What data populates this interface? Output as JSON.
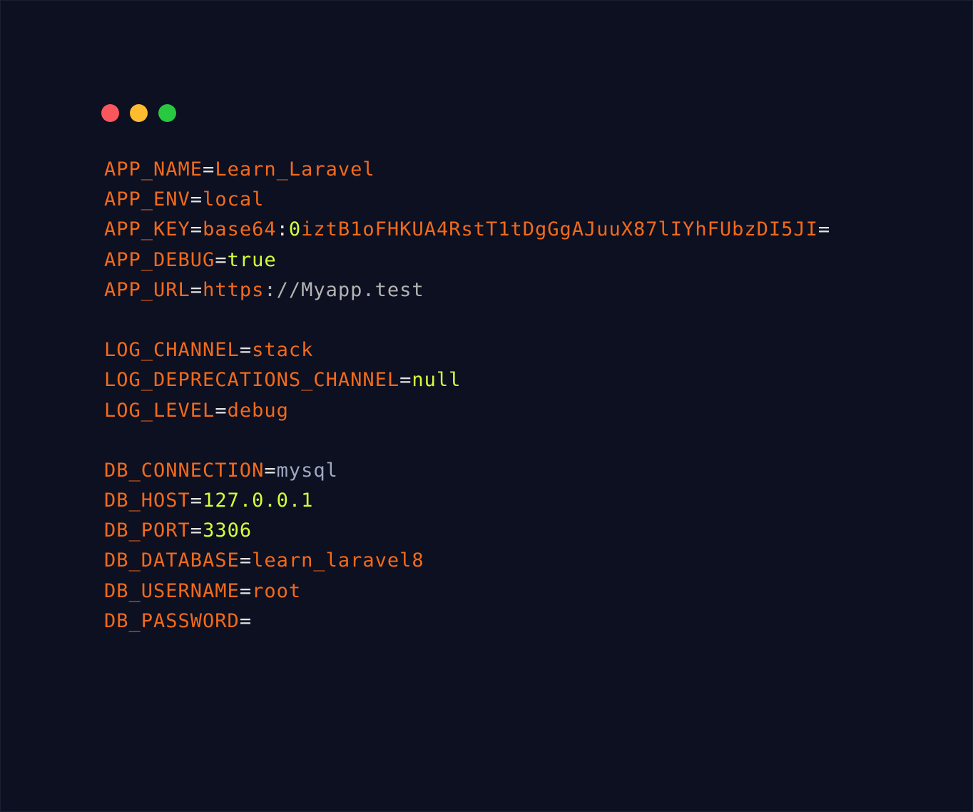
{
  "window": {
    "background": "#0c1021",
    "buttons": [
      {
        "name": "close",
        "color": "#f9575c"
      },
      {
        "name": "minimize",
        "color": "#fdbb2f"
      },
      {
        "name": "maximize",
        "color": "#28c841"
      }
    ]
  },
  "colors": {
    "key": "#f26a1b",
    "equals": "#e5e5e5",
    "value_orange": "#f26a1b",
    "value_lime": "#d5ff3a",
    "value_slate": "#a0a7c2",
    "value_gray": "#b3b3b3"
  },
  "lines": [
    {
      "type": "entry",
      "segments": [
        {
          "text": "APP_NAME",
          "color": "#f26a1b"
        },
        {
          "text": "=",
          "color": "#e5e5e5"
        },
        {
          "text": "Learn_Laravel",
          "color": "#f26a1b"
        }
      ]
    },
    {
      "type": "entry",
      "segments": [
        {
          "text": "APP_ENV",
          "color": "#f26a1b"
        },
        {
          "text": "=",
          "color": "#e5e5e5"
        },
        {
          "text": "local",
          "color": "#f26a1b"
        }
      ]
    },
    {
      "type": "entry",
      "segments": [
        {
          "text": "APP_KEY",
          "color": "#f26a1b"
        },
        {
          "text": "=",
          "color": "#e5e5e5"
        },
        {
          "text": "base64",
          "color": "#f26a1b"
        },
        {
          "text": ":",
          "color": "#e5e5e5"
        },
        {
          "text": "0",
          "color": "#d5ff3a"
        },
        {
          "text": "iztB1oFHKUA4RstT1tDgGgAJuuX87lIYhFUbzDI5JI",
          "color": "#f26a1b"
        },
        {
          "text": "=",
          "color": "#e5e5e5"
        }
      ]
    },
    {
      "type": "entry",
      "segments": [
        {
          "text": "APP_DEBUG",
          "color": "#f26a1b"
        },
        {
          "text": "=",
          "color": "#e5e5e5"
        },
        {
          "text": "true",
          "color": "#d5ff3a"
        }
      ]
    },
    {
      "type": "entry",
      "segments": [
        {
          "text": "APP_URL",
          "color": "#f26a1b"
        },
        {
          "text": "=",
          "color": "#e5e5e5"
        },
        {
          "text": "https",
          "color": "#f26a1b"
        },
        {
          "text": "://Myapp.test",
          "color": "#b3b3b3"
        }
      ]
    },
    {
      "type": "blank"
    },
    {
      "type": "entry",
      "segments": [
        {
          "text": "LOG_CHANNEL",
          "color": "#f26a1b"
        },
        {
          "text": "=",
          "color": "#e5e5e5"
        },
        {
          "text": "stack",
          "color": "#f26a1b"
        }
      ]
    },
    {
      "type": "entry",
      "segments": [
        {
          "text": "LOG_DEPRECATIONS_CHANNEL",
          "color": "#f26a1b"
        },
        {
          "text": "=",
          "color": "#e5e5e5"
        },
        {
          "text": "null",
          "color": "#d5ff3a"
        }
      ]
    },
    {
      "type": "entry",
      "segments": [
        {
          "text": "LOG_LEVEL",
          "color": "#f26a1b"
        },
        {
          "text": "=",
          "color": "#e5e5e5"
        },
        {
          "text": "debug",
          "color": "#f26a1b"
        }
      ]
    },
    {
      "type": "blank"
    },
    {
      "type": "entry",
      "segments": [
        {
          "text": "DB_CONNECTION",
          "color": "#f26a1b"
        },
        {
          "text": "=",
          "color": "#e5e5e5"
        },
        {
          "text": "mysql",
          "color": "#a0a7c2"
        }
      ]
    },
    {
      "type": "entry",
      "segments": [
        {
          "text": "DB_HOST",
          "color": "#f26a1b"
        },
        {
          "text": "=",
          "color": "#e5e5e5"
        },
        {
          "text": "127.0.0.1",
          "color": "#d5ff3a"
        }
      ]
    },
    {
      "type": "entry",
      "segments": [
        {
          "text": "DB_PORT",
          "color": "#f26a1b"
        },
        {
          "text": "=",
          "color": "#e5e5e5"
        },
        {
          "text": "3306",
          "color": "#d5ff3a"
        }
      ]
    },
    {
      "type": "entry",
      "segments": [
        {
          "text": "DB_DATABASE",
          "color": "#f26a1b"
        },
        {
          "text": "=",
          "color": "#e5e5e5"
        },
        {
          "text": "learn_laravel8",
          "color": "#f26a1b"
        }
      ]
    },
    {
      "type": "entry",
      "segments": [
        {
          "text": "DB_USERNAME",
          "color": "#f26a1b"
        },
        {
          "text": "=",
          "color": "#e5e5e5"
        },
        {
          "text": "root",
          "color": "#f26a1b"
        }
      ]
    },
    {
      "type": "entry",
      "segments": [
        {
          "text": "DB_PASSWORD",
          "color": "#f26a1b"
        },
        {
          "text": "=",
          "color": "#e5e5e5"
        }
      ]
    }
  ]
}
